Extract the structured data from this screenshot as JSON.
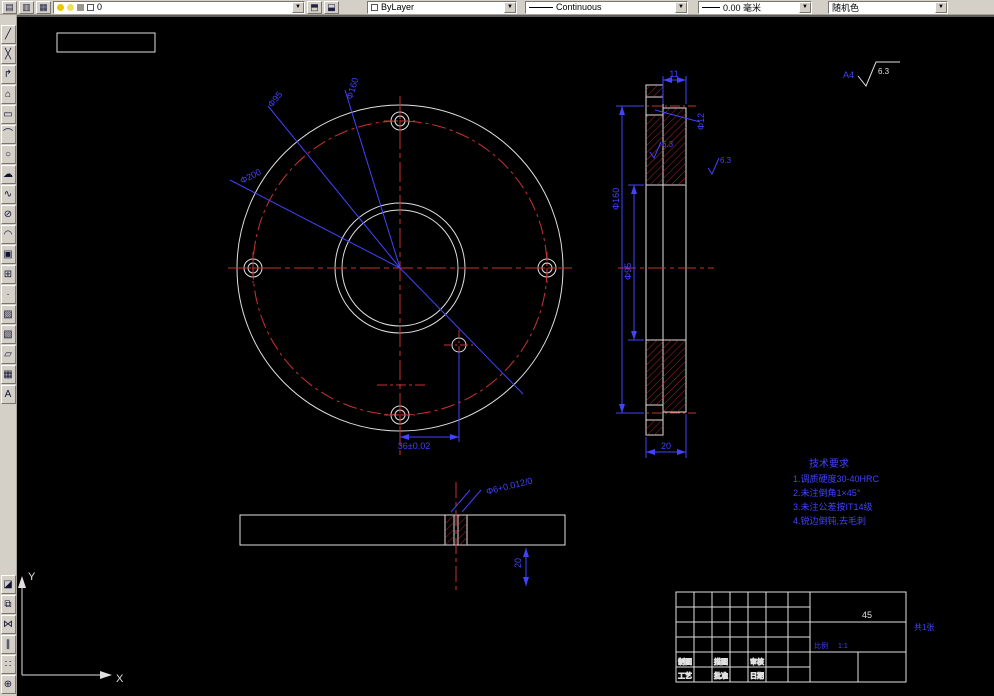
{
  "chrome": {
    "top_toolbar": {
      "buttons_left": [
        {
          "name": "layer-properties-manager",
          "glyph": "▤"
        },
        {
          "name": "layer-states",
          "glyph": "▥"
        },
        {
          "name": "layer-isolate",
          "glyph": "▦"
        }
      ],
      "layer": {
        "value": "0"
      },
      "buttons_after": [
        {
          "name": "make-object-layer-current",
          "glyph": "⬒"
        },
        {
          "name": "layer-previous",
          "glyph": "⬓"
        }
      ],
      "color_value": "ByLayer",
      "linetype_value": "Continuous",
      "lineweight_value": "0.00 毫米",
      "plotstyle_value": "随机色",
      "dropdown_glyph": "▼"
    },
    "left_toolbar": {
      "items": [
        {
          "name": "line",
          "glyph": "╱"
        },
        {
          "name": "construction-line",
          "glyph": "╳"
        },
        {
          "name": "polyline",
          "glyph": "↱"
        },
        {
          "name": "polygon",
          "glyph": "⌂"
        },
        {
          "name": "rectangle",
          "glyph": "▭"
        },
        {
          "name": "arc",
          "glyph": "⌒"
        },
        {
          "name": "circle",
          "glyph": "○"
        },
        {
          "name": "revision-cloud",
          "glyph": "☁"
        },
        {
          "name": "spline",
          "glyph": "∿"
        },
        {
          "name": "ellipse",
          "glyph": "⊘"
        },
        {
          "name": "ellipse-arc",
          "glyph": "◠"
        },
        {
          "name": "insert-block",
          "glyph": "▣"
        },
        {
          "name": "make-block",
          "glyph": "⊞"
        },
        {
          "name": "point",
          "glyph": "·"
        },
        {
          "name": "hatch",
          "glyph": "▨"
        },
        {
          "name": "gradient",
          "glyph": "▧"
        },
        {
          "name": "region",
          "glyph": "▱"
        },
        {
          "name": "table",
          "glyph": "▦"
        },
        {
          "name": "multiline-text",
          "glyph": "A"
        }
      ]
    },
    "bottom_left_toolbar": {
      "items": [
        {
          "name": "erase",
          "glyph": "◪"
        },
        {
          "name": "copy",
          "glyph": "⧉"
        },
        {
          "name": "mirror",
          "glyph": "⋈"
        },
        {
          "name": "offset",
          "glyph": "∥"
        },
        {
          "name": "array",
          "glyph": "∷"
        },
        {
          "name": "move",
          "glyph": "⊕"
        }
      ]
    }
  },
  "drawing": {
    "colors": {
      "line": "#e0e0e0",
      "center": "#c83232",
      "dim": "#4242ff",
      "hatch": "#c83232"
    },
    "front_view": {
      "dim_phi95": "Φ95",
      "dim_phi160": "Φ160",
      "dim_phi200": "Φ200",
      "dim_36": "36±0.02"
    },
    "section_view": {
      "dim_11": "11",
      "dim_phi12": "Φ12",
      "dim_phi95": "Φ95",
      "dim_phi160": "Φ160",
      "dim_20": "20",
      "roughness_1": "6.3",
      "roughness_2": "6.3"
    },
    "bottom_view": {
      "dim_phi6": "Φ6+0.012/0",
      "dim_20": "20"
    },
    "sheet": {
      "size_label": "A4",
      "default_roughness": "6.3"
    },
    "notes": {
      "title": "技术要求",
      "lines": [
        "1.调质硬度30-40HRC",
        "2.未注倒角1×45°",
        "3.未注公差按IT14级",
        "4.锐边倒钝,去毛刺"
      ]
    },
    "title_block": {
      "material": "45",
      "row1": [
        "制图",
        "描图",
        "审核"
      ],
      "row2": [
        "工艺",
        "批准",
        "日期"
      ],
      "scale_label": "比例",
      "scale_value": "1:1",
      "sheet_count": "共1张"
    },
    "ucs": {
      "x_label": "X",
      "y_label": "Y"
    }
  }
}
